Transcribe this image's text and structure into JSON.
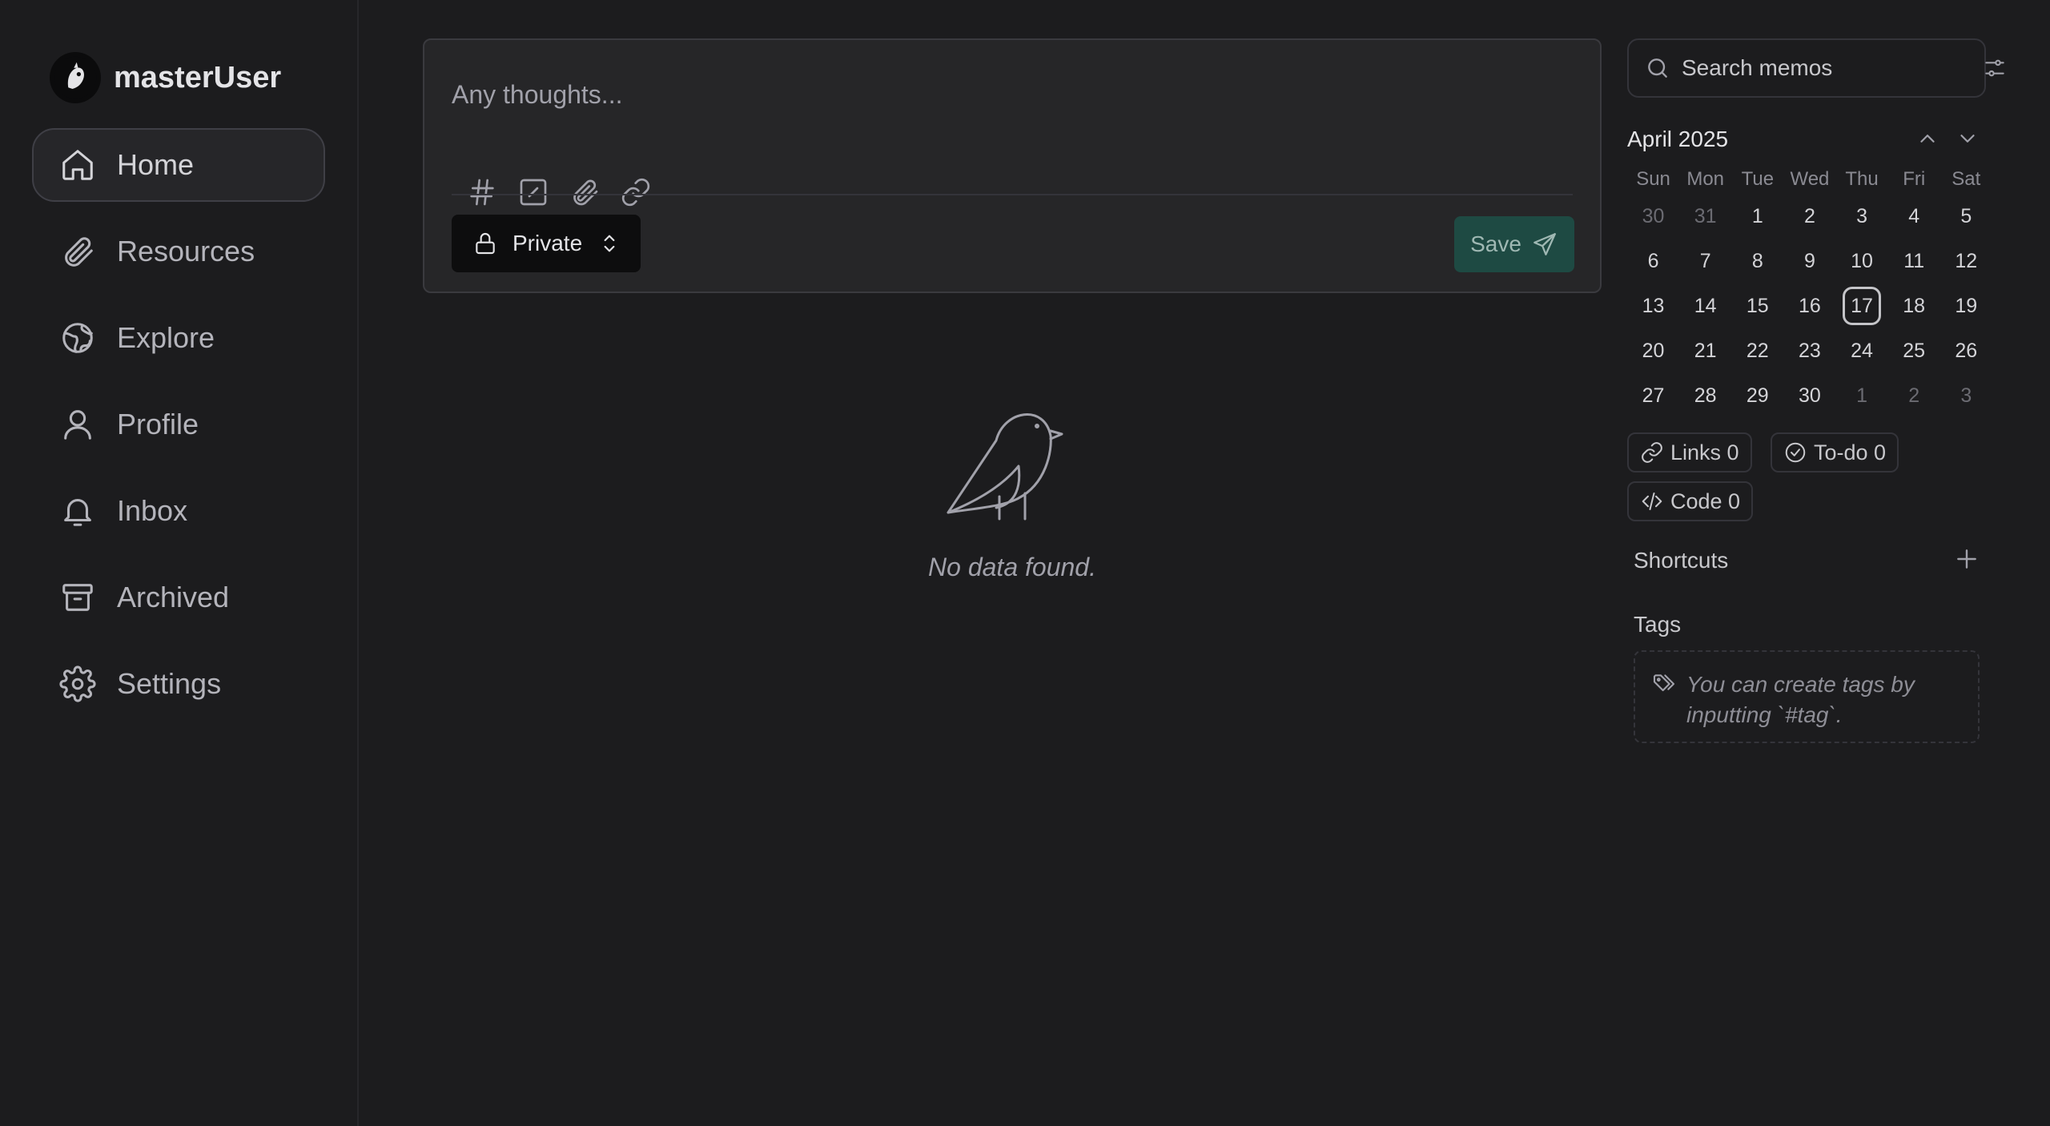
{
  "user": {
    "name": "masterUser"
  },
  "nav": [
    {
      "label": "Home",
      "icon": "home-icon",
      "active": true
    },
    {
      "label": "Resources",
      "icon": "paperclip-icon"
    },
    {
      "label": "Explore",
      "icon": "globe-icon"
    },
    {
      "label": "Profile",
      "icon": "user-icon"
    },
    {
      "label": "Inbox",
      "icon": "bell-icon"
    },
    {
      "label": "Archived",
      "icon": "archive-icon"
    },
    {
      "label": "Settings",
      "icon": "gear-icon"
    }
  ],
  "editor": {
    "placeholder": "Any thoughts...",
    "tools": [
      "hash-icon",
      "checkbox-icon",
      "paperclip-icon",
      "link-icon"
    ],
    "visibility": "Private",
    "save_label": "Save"
  },
  "empty": {
    "text": "No data found."
  },
  "search": {
    "placeholder": "Search memos"
  },
  "calendar": {
    "title": "April 2025",
    "weekdays": [
      "Sun",
      "Mon",
      "Tue",
      "Wed",
      "Thu",
      "Fri",
      "Sat"
    ],
    "weeks": [
      [
        "30",
        "31",
        "1",
        "2",
        "3",
        "4",
        "5"
      ],
      [
        "6",
        "7",
        "8",
        "9",
        "10",
        "11",
        "12"
      ],
      [
        "13",
        "14",
        "15",
        "16",
        "17",
        "18",
        "19"
      ],
      [
        "20",
        "21",
        "22",
        "23",
        "24",
        "25",
        "26"
      ],
      [
        "27",
        "28",
        "29",
        "30",
        "1",
        "2",
        "3"
      ]
    ],
    "today": "17"
  },
  "stats": {
    "links": "Links 0",
    "todo": "To-do 0",
    "code": "Code 0"
  },
  "shortcuts": {
    "title": "Shortcuts"
  },
  "tags": {
    "title": "Tags",
    "empty_text": "You can create tags by inputting `#tag`."
  },
  "colors": {
    "background": "#1c1c1e",
    "save_button": "#1e4a43",
    "active_nav": "#262629"
  }
}
